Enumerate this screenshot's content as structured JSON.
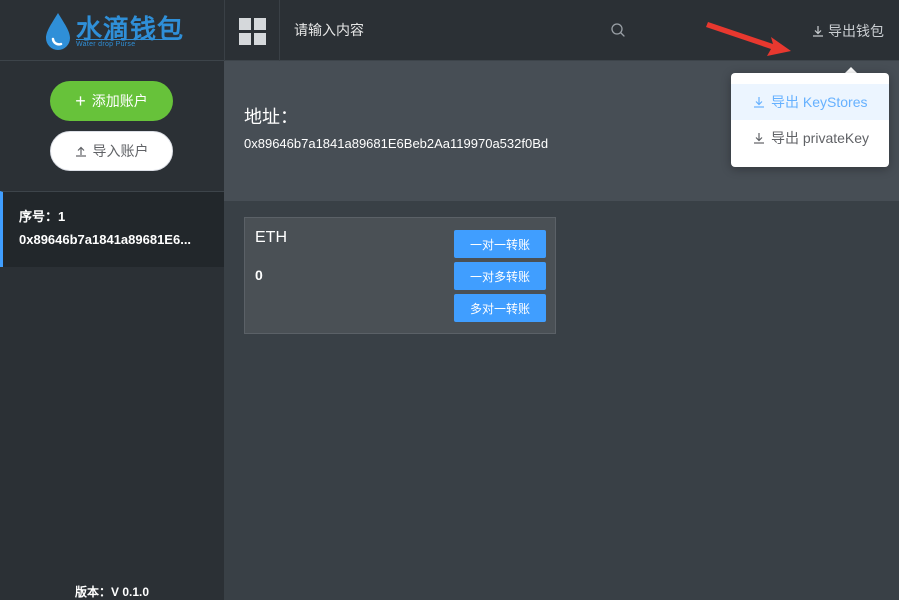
{
  "logo": {
    "title": "水滴钱包",
    "subtitle": "Water drop Purse"
  },
  "header": {
    "search_placeholder": "请输入内容",
    "export_label": "导出钱包"
  },
  "sidebar": {
    "add_account_label": "添加账户",
    "import_account_label": "导入账户",
    "accounts": [
      {
        "index_label": "序号：1",
        "address": "0x89646b7a1841a89681E6..."
      }
    ],
    "version": "版本：V 0.1.0"
  },
  "address_panel": {
    "label": "地址：",
    "value": "0x89646b7a1841a89681E6Beb2Aa119970a532f0Bd"
  },
  "asset_card": {
    "token": "ETH",
    "balance": "0",
    "buttons": [
      "一对一转账",
      "一对多转账",
      "多对一转账"
    ]
  },
  "export_menu": {
    "items": [
      "导出 KeyStores",
      "导出 privateKey"
    ]
  },
  "colors": {
    "accent": "#409eff",
    "green": "#67c23a",
    "header_bg": "#2b3035",
    "content_bg": "#394046",
    "annotation_arrow": "#e8382f"
  }
}
